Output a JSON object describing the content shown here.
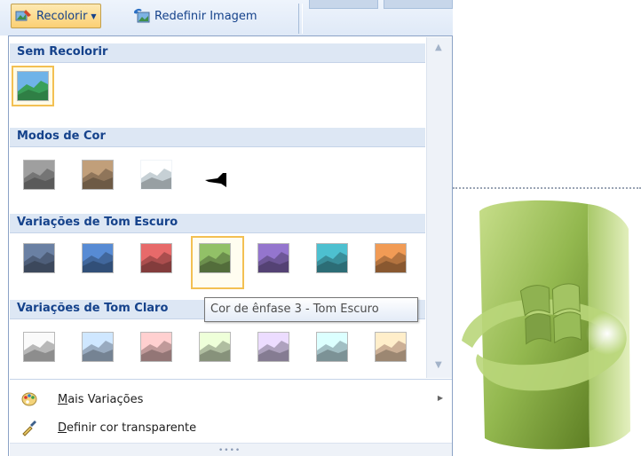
{
  "ribbon": {
    "recolor_label": "Recolorir",
    "reset_label": "Redefinir Imagem"
  },
  "sections": {
    "no_recolor": "Sem Recolorir",
    "color_modes": "Modos de Cor",
    "dark_variations": "Variações de Tom Escuro",
    "light_variations": "Variações de Tom Claro"
  },
  "tooltip": "Cor de ênfase 3 - Tom Escuro",
  "menu": {
    "more_variations": "Mais Variações",
    "set_transparent": "Definir cor transparente"
  },
  "swatch_colors": {
    "original": [
      "#6fb3e8",
      "#3aa05a"
    ],
    "modes": [
      "#8a8a8a",
      "#a88a6a",
      "#e9f5fb",
      "#ffffff"
    ],
    "dark": [
      "#5c6f8e",
      "#4c79b8",
      "#c95c5c",
      "#7fa85a",
      "#8166b3",
      "#43a7b5",
      "#d2874a"
    ],
    "light": [
      "#d9d9d9",
      "#b4c9e2",
      "#e2b5b5",
      "#cfe0bd",
      "#cdbfe0",
      "#bfe1e6",
      "#f0cfb0"
    ]
  },
  "selected_swatch": "Cor de ênfase 3 - Tom Escuro"
}
